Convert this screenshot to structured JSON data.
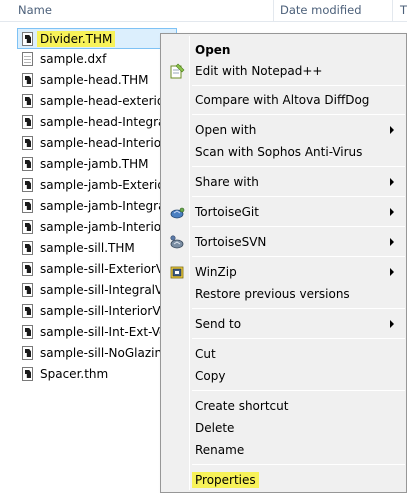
{
  "columns": {
    "name": "Name",
    "date_modified": "Date modified",
    "type": "T"
  },
  "files": [
    {
      "name": "Divider.THM",
      "kind": "thm",
      "selected": true
    },
    {
      "name": "sample.dxf",
      "kind": "doc"
    },
    {
      "name": "sample-head.THM",
      "kind": "thm"
    },
    {
      "name": "sample-head-exteriorV",
      "kind": "thm"
    },
    {
      "name": "sample-head-IntegralV",
      "kind": "thm"
    },
    {
      "name": "sample-head-InteriorV",
      "kind": "thm"
    },
    {
      "name": "sample-jamb.THM",
      "kind": "thm"
    },
    {
      "name": "sample-jamb-ExteriorV",
      "kind": "thm"
    },
    {
      "name": "sample-jamb-IntegralV",
      "kind": "thm"
    },
    {
      "name": "sample-jamb-InteriorV",
      "kind": "thm"
    },
    {
      "name": "sample-sill.THM",
      "kind": "thm"
    },
    {
      "name": "sample-sill-ExteriorVer",
      "kind": "thm"
    },
    {
      "name": "sample-sill-IntegralVer",
      "kind": "thm"
    },
    {
      "name": "sample-sill-InteriorVer",
      "kind": "thm"
    },
    {
      "name": "sample-sill-Int-Ext-Ver",
      "kind": "thm"
    },
    {
      "name": "sample-sill-NoGlazing.",
      "kind": "thm"
    },
    {
      "name": "Spacer.thm",
      "kind": "thm"
    }
  ],
  "menu": {
    "open": "Open",
    "edit_notepad": "Edit with Notepad++",
    "compare_diffdog": "Compare with Altova DiffDog",
    "open_with": "Open with",
    "scan_sophos": "Scan with Sophos Anti-Virus",
    "share_with": "Share with",
    "tortoisegit": "TortoiseGit",
    "tortoisesvn": "TortoiseSVN",
    "winzip": "WinZip",
    "restore_versions": "Restore previous versions",
    "send_to": "Send to",
    "cut": "Cut",
    "copy": "Copy",
    "create_shortcut": "Create shortcut",
    "delete": "Delete",
    "rename": "Rename",
    "properties": "Properties"
  },
  "icons": {
    "notepad": "notepad-plus-plus-icon",
    "tortoisegit": "tortoisegit-icon",
    "tortoisesvn": "tortoisesvn-icon",
    "winzip": "winzip-icon"
  },
  "colors": {
    "highlight": "#f7f259",
    "selection": "#dceffd",
    "menu_bg": "#f0f0f0"
  }
}
